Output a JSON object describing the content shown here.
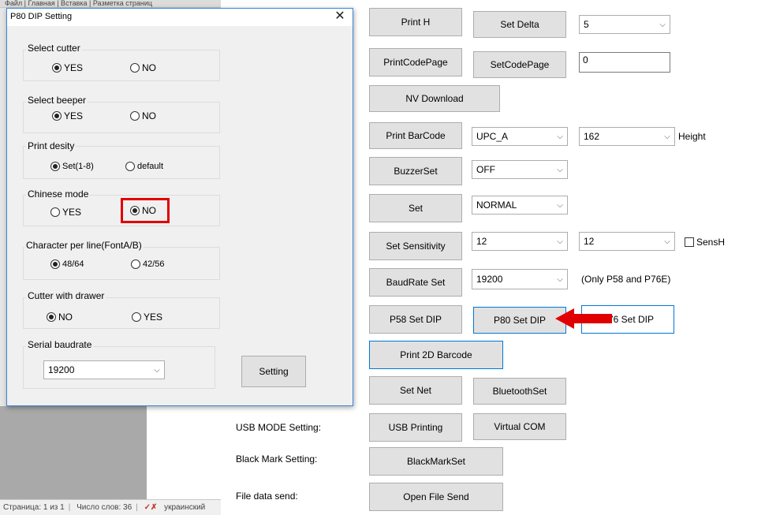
{
  "word": {
    "ribbon_text": "Файл | Главная | Вставка | Разметка страниц",
    "status": {
      "page": "Страница: 1 из 1",
      "words": "Число слов: 36",
      "lang": "украинский"
    }
  },
  "tool": {
    "print_h": "Print H",
    "set_delta": "Set Delta",
    "delta_value": "5",
    "print_code_page": "PrintCodePage",
    "set_code_page": "SetCodePage",
    "code_page_value": "0",
    "nv_download": "NV Download",
    "print_barcode": "Print BarCode",
    "barcode_type": "UPC_A",
    "barcode_height": "162",
    "height_label": "Height",
    "buzzer_set": "BuzzerSet",
    "buzzer_value": "OFF",
    "set": "Set",
    "set_value": "NORMAL",
    "set_sensitivity": "Set Sensitivity",
    "sens_value1": "12",
    "sens_value2": "12",
    "sensh_label": "SensH",
    "baudrate_set": "BaudRate Set",
    "baud_value": "19200",
    "baud_note": "(Only P58 and P76E)",
    "p58_set_dip": "P58 Set DIP",
    "p80_set_dip": "P80 Set DIP",
    "p76_set_dip": "P76 Set DIP",
    "print_2d_barcode": "Print 2D Barcode",
    "set_net": "Set Net",
    "bluetooth_set": "BluetoothSet",
    "usb_mode_label": "USB MODE Setting:",
    "usb_printing": "USB Printing",
    "virtual_com": "Virtual COM",
    "black_mark_label": "Black Mark Setting:",
    "black_mark_set": "BlackMarkSet",
    "file_send_label": "File data send:",
    "open_file_send": "Open File Send"
  },
  "dialog": {
    "title": "P80 DIP Setting",
    "close": "✕",
    "cutter": {
      "title": "Select cutter",
      "opt1": "YES",
      "opt2": "NO"
    },
    "beeper": {
      "title": "Select beeper",
      "opt1": "YES",
      "opt2": "NO"
    },
    "density": {
      "title": "Print desity",
      "opt1": "Set(1-8)",
      "opt2": "default"
    },
    "chinese": {
      "title": "Chinese mode",
      "opt1": "YES",
      "opt2": "NO"
    },
    "charline": {
      "title": "Character per line(FontA/B)",
      "opt1": "48/64",
      "opt2": "42/56"
    },
    "drawer": {
      "title": "Cutter with drawer",
      "opt1": "NO",
      "opt2": "YES"
    },
    "baud": {
      "title": "Serial baudrate",
      "value": "19200"
    },
    "setting_button": "Setting"
  },
  "colors": {
    "highlight": "#e00000",
    "accent": "#0078d7"
  }
}
